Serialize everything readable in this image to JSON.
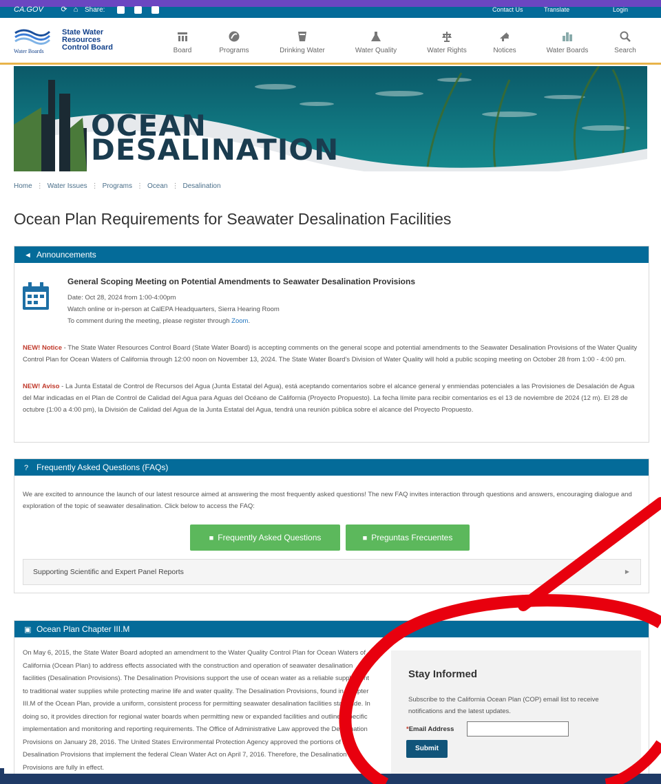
{
  "topbar": {
    "cagov": "CA.GOV",
    "share_label": "Share:",
    "right_links": [
      "Contact Us",
      "Translate",
      "Login"
    ]
  },
  "header": {
    "logo_line1": "State Water",
    "logo_line2": "Resources",
    "logo_line3": "Control Board",
    "logo_caption": "Water Boards",
    "nav": [
      {
        "label": "Board",
        "icon": "board-icon"
      },
      {
        "label": "Programs",
        "icon": "programs-icon"
      },
      {
        "label": "Drinking Water",
        "icon": "drinking-water-icon"
      },
      {
        "label": "Water Quality",
        "icon": "water-quality-icon"
      },
      {
        "label": "Water Rights",
        "icon": "water-rights-icon"
      },
      {
        "label": "Notices",
        "icon": "notices-icon"
      },
      {
        "label": "Water Boards",
        "icon": "water-boards-icon"
      },
      {
        "label": "Search",
        "icon": "search-icon"
      }
    ]
  },
  "banner": {
    "title_line1": "OCEAN",
    "title_line2": "DESALINATION"
  },
  "breadcrumb": [
    "Home",
    "Water Issues",
    "Programs",
    "Ocean",
    "Desalination"
  ],
  "page_title": "Ocean Plan Requirements for Seawater Desalination Facilities",
  "announcements": {
    "heading": "Announcements",
    "event_title": "General Scoping Meeting on Potential Amendments to Seawater Desalination Provisions",
    "date_line": "Date: Oct 28, 2024 from 1:00-4:00pm",
    "location_line": "Watch online or in-person at CalEPA Headquarters, Sierra Hearing Room",
    "register_prefix": "To comment during the meeting, please register through ",
    "register_link": "Zoom",
    "register_suffix": ".",
    "notice_new": "NEW!",
    "notice_label": "Notice",
    "notice_text": " - The State Water Resources Control Board (State Water Board) is accepting comments on the general scope and potential amendments to the Seawater Desalination Provisions of the Water Quality Control Plan for Ocean Waters of California through 12:00 noon on November 13, 2024. The State Water Board's Division of Water Quality will hold a public scoping meeting on October 28 from 1:00 - 4:00 pm.",
    "aviso_new": "NEW!",
    "aviso_label": "Aviso",
    "aviso_text": " - La Junta Estatal de Control de Recursos del Agua (Junta Estatal del Agua), está aceptando comentarios sobre el alcance general y enmiendas potenciales a las Provisiones de Desalación de Agua del Mar indicadas en el Plan de Control de Calidad del Agua para Aguas del Océano de California (Proyecto Propuesto). La fecha límite para recibir comentarios es el 13 de noviembre de 2024 (12 m). El 28 de octubre (1:00 a 4:00 pm), la División de Calidad del Agua de la Junta Estatal del Agua, tendrá una reunión pública sobre el alcance del Proyecto Propuesto."
  },
  "faq": {
    "heading": "Frequently Asked Questions (FAQs)",
    "intro": "We are excited to announce the launch of our latest resource aimed at answering the most frequently asked questions! The new FAQ invites interaction through questions and answers, encouraging dialogue and exploration of the topic of seawater desalination. Click below to access the FAQ:",
    "button_en": "Frequently Asked Questions",
    "button_es": "Preguntas Frecuentes",
    "accordion_label": "Supporting Scientific and Expert Panel Reports"
  },
  "chapter": {
    "heading": "Ocean Plan Chapter III.M",
    "text": "On May 6, 2015, the State Water Board adopted an amendment to the Water Quality Control Plan for Ocean Waters of California (Ocean Plan) to address effects associated with the construction and operation of seawater desalination facilities (Desalination Provisions). The Desalination Provisions support the use of ocean water as a reliable supplement to traditional water supplies while protecting marine life and water quality. The Desalination Provisions, found in Chapter III.M of the Ocean Plan, provide a uniform, consistent process for permitting seawater desalination facilities statewide. In doing so, it provides direction for regional water boards when permitting new or expanded facilities and outlines specific implementation and monitoring and reporting requirements. The Office of Administrative Law approved the Desalination Provisions on January 28, 2016. The United States Environmental Protection Agency approved the portions of the Desalination Provisions that implement the federal Clean Water Act on April 7, 2016. Therefore, the Desalination Provisions are fully in effect."
  },
  "subscribe": {
    "heading": "Stay Informed",
    "text": "Subscribe to the California Ocean Plan (COP) email list to receive notifications and the latest updates.",
    "email_label": "Email Address",
    "email_value": "",
    "submit_label": "Submit"
  },
  "colors": {
    "panel_header": "#046b99",
    "green_button": "#5cb85c",
    "submit_button": "#11557a",
    "annotation": "#e8000e",
    "new_label": "#c0392b"
  }
}
